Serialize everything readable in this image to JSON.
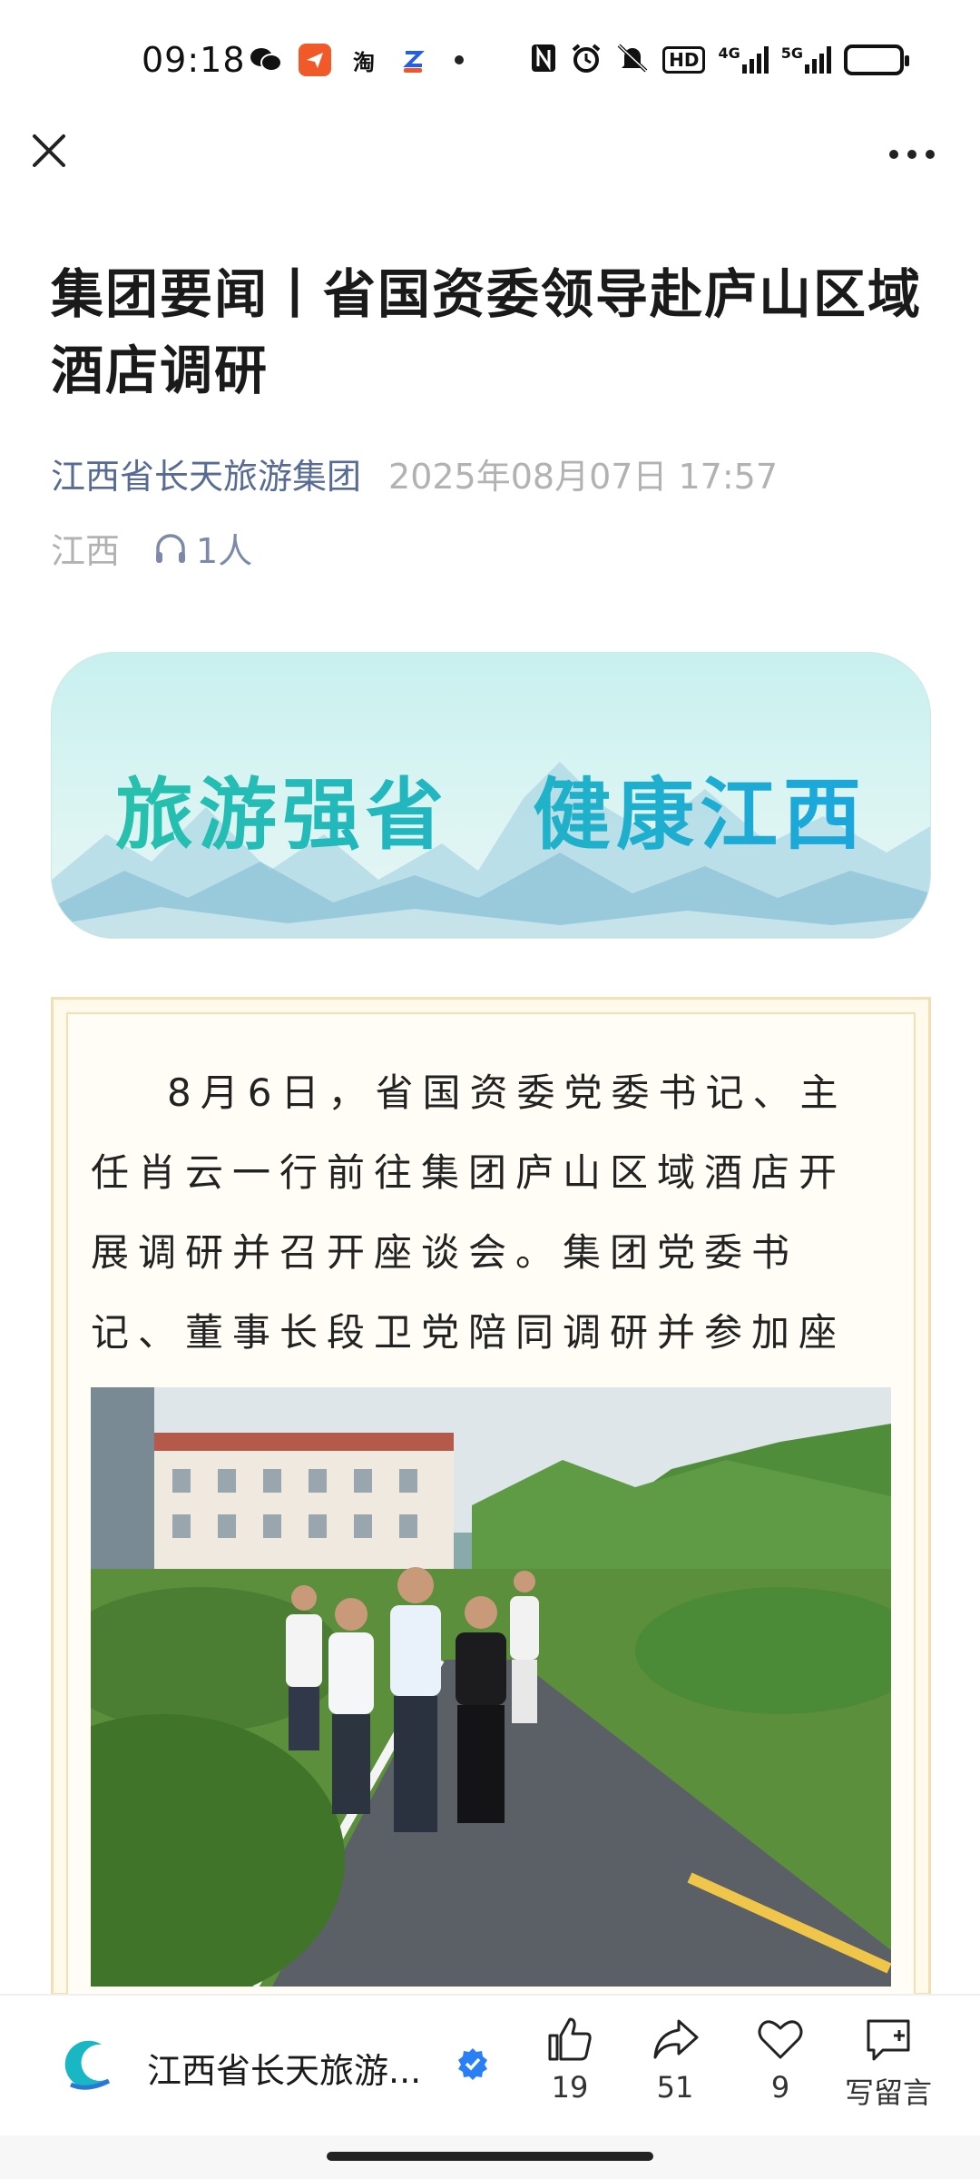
{
  "status_bar": {
    "time": "09:18",
    "apps": [
      "wechat-icon",
      "message-icon",
      "taobao-icon",
      "cloud-icon"
    ],
    "taobao_label": "淘",
    "network": [
      "nfc-icon",
      "alarm-icon",
      "mute-icon",
      "hd-icon",
      "4g-signal-icon",
      "5g-signal-icon",
      "battery-icon"
    ],
    "hd_label": "HD",
    "net1_label": "4G",
    "net2_label": "5G"
  },
  "nav": {
    "close_icon": "close-icon",
    "more_icon": "more-icon"
  },
  "article": {
    "title": "集团要闻丨省国资委领导赴庐山区域酒店调研",
    "account": "江西省长天旅游集团",
    "publish_time": "2025年08月07日 17:57",
    "region": "江西",
    "listeners": "1人",
    "banner_text": "旅游强省　健康江西",
    "paragraph": "8月6日，省国资委党委书记、主任肖云一行前往集团庐山区域酒店开展调研并召开座谈会。集团党委书记、董事长段卫党陪同调研并参加座谈。"
  },
  "bottom_bar": {
    "account_name": "江西省长天旅游...",
    "like_count": "19",
    "share_count": "51",
    "favorite_count": "9",
    "comment_label": "写留言"
  },
  "colors": {
    "account_link": "#576b95",
    "muted": "#b2b2b2",
    "frame_border": "#f1e0b4",
    "banner_text_start": "#27c3a8",
    "banner_text_end": "#1aa4e0",
    "verified": "#2b7ff5"
  }
}
